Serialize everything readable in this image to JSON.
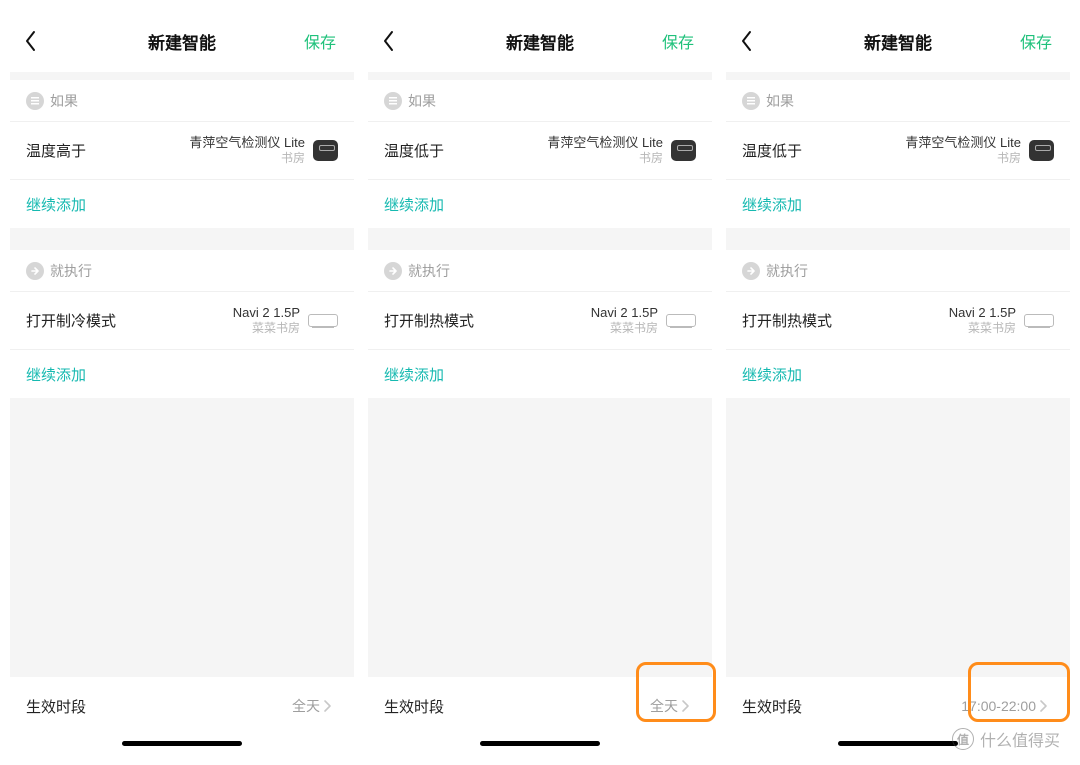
{
  "common": {
    "title": "新建智能",
    "save": "保存",
    "if_label": "如果",
    "then_label": "就执行",
    "add_more": "继续添加",
    "period_label": "生效时段"
  },
  "phones": [
    {
      "condition_title": "温度高于",
      "condition_device": "青萍空气检测仪 Lite",
      "condition_room": "书房",
      "action_title": "打开制冷模式",
      "action_device": "Navi 2 1.5P",
      "action_room": "菜菜书房",
      "period_value": "全天",
      "highlight": false
    },
    {
      "condition_title": "温度低于",
      "condition_device": "青萍空气检测仪 Lite",
      "condition_room": "书房",
      "action_title": "打开制热模式",
      "action_device": "Navi 2 1.5P",
      "action_room": "菜菜书房",
      "period_value": "全天",
      "highlight": true
    },
    {
      "condition_title": "温度低于",
      "condition_device": "青萍空气检测仪 Lite",
      "condition_room": "书房",
      "action_title": "打开制热模式",
      "action_device": "Navi 2 1.5P",
      "action_room": "菜菜书房",
      "period_value": "17:00-22:00",
      "highlight": true
    }
  ],
  "watermark": "什么值得买"
}
